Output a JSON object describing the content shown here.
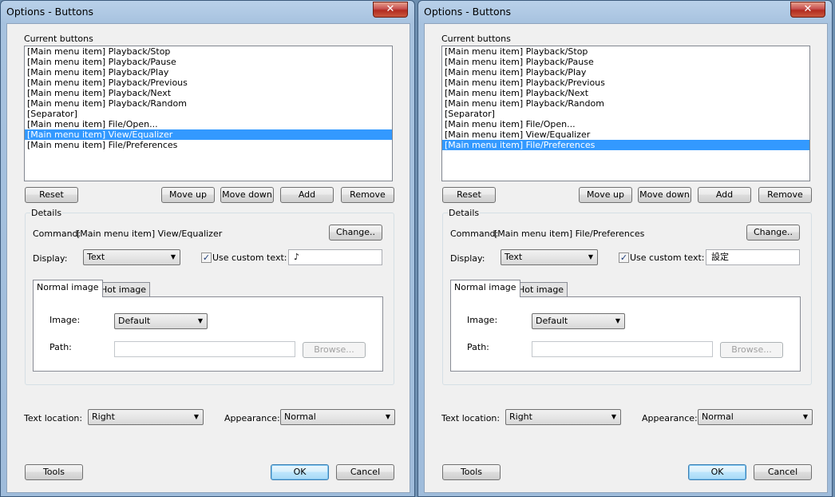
{
  "windows": [
    {
      "title": "Options - Buttons",
      "close_label": "✕",
      "current_buttons_label": "Current buttons",
      "list_items": [
        "[Main menu item] Playback/Stop",
        "[Main menu item] Playback/Pause",
        "[Main menu item] Playback/Play",
        "[Main menu item] Playback/Previous",
        "[Main menu item] Playback/Next",
        "[Main menu item] Playback/Random",
        "[Separator]",
        "[Main menu item] File/Open...",
        "[Main menu item] View/Equalizer",
        "[Main menu item] File/Preferences"
      ],
      "selected_index": 8,
      "buttons": {
        "reset": "Reset",
        "move_up": "Move up",
        "move_down": "Move down",
        "add": "Add",
        "remove": "Remove"
      },
      "details": {
        "label": "Details",
        "command_label": "Command:",
        "command_value": "[Main menu item] View/Equalizer",
        "change_button": "Change..",
        "display_label": "Display:",
        "display_value": "Text",
        "use_custom_text_label": "Use custom text:",
        "use_custom_text_checked": true,
        "custom_text_value": "♪",
        "tabs": [
          "Normal image",
          "Hot image"
        ],
        "active_tab": 0,
        "image_label": "Image:",
        "image_value": "Default",
        "path_label": "Path:",
        "path_value": "",
        "browse_button": "Browse..."
      },
      "text_location_label": "Text location:",
      "text_location_value": "Right",
      "appearance_label": "Appearance:",
      "appearance_value": "Normal",
      "tools_button": "Tools",
      "ok_button": "OK",
      "cancel_button": "Cancel"
    },
    {
      "title": "Options - Buttons",
      "close_label": "✕",
      "current_buttons_label": "Current buttons",
      "list_items": [
        "[Main menu item] Playback/Stop",
        "[Main menu item] Playback/Pause",
        "[Main menu item] Playback/Play",
        "[Main menu item] Playback/Previous",
        "[Main menu item] Playback/Next",
        "[Main menu item] Playback/Random",
        "[Separator]",
        "[Main menu item] File/Open...",
        "[Main menu item] View/Equalizer",
        "[Main menu item] File/Preferences"
      ],
      "selected_index": 9,
      "buttons": {
        "reset": "Reset",
        "move_up": "Move up",
        "move_down": "Move down",
        "add": "Add",
        "remove": "Remove"
      },
      "details": {
        "label": "Details",
        "command_label": "Command:",
        "command_value": "[Main menu item] File/Preferences",
        "change_button": "Change..",
        "display_label": "Display:",
        "display_value": "Text",
        "use_custom_text_label": "Use custom text:",
        "use_custom_text_checked": true,
        "custom_text_value": "設定",
        "tabs": [
          "Normal image",
          "Hot image"
        ],
        "active_tab": 0,
        "image_label": "Image:",
        "image_value": "Default",
        "path_label": "Path:",
        "path_value": "",
        "browse_button": "Browse..."
      },
      "text_location_label": "Text location:",
      "text_location_value": "Right",
      "appearance_label": "Appearance:",
      "appearance_value": "Normal",
      "tools_button": "Tools",
      "ok_button": "OK",
      "cancel_button": "Cancel"
    }
  ],
  "icons": {
    "dropdown_arrow": "▼",
    "check_mark": "✓"
  }
}
